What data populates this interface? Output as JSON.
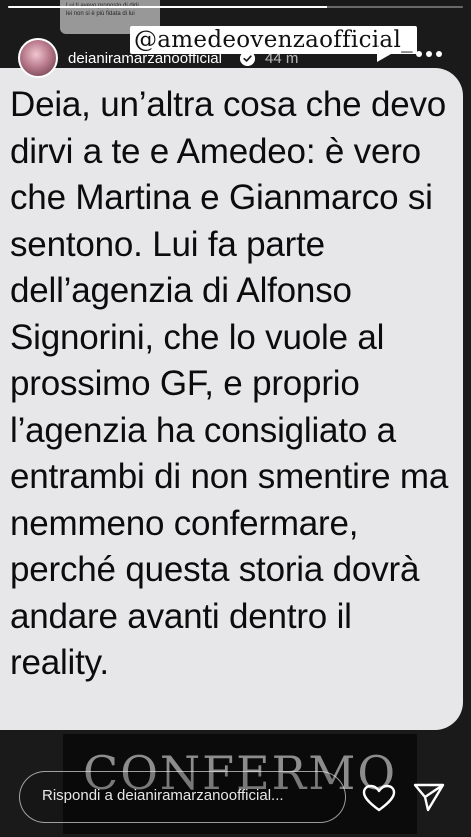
{
  "story": {
    "progress": 0.7,
    "background_chat": [
      "Lui ti avevo proposto di dirli",
      "lei non si è più fidata di lui"
    ]
  },
  "header": {
    "username": "deianiramarzanoofficial",
    "time": "44 m",
    "mention": "@amedeovenzaofficial_",
    "verified_icon": "verified-badge-icon",
    "play_icon": "play-icon",
    "more_icon": "more-options-icon"
  },
  "card": {
    "text": "Deia, un’altra cosa che devo dirvi a te e Amedeo: è vero che Martina e Gianmarco si sentono. Lui fa parte dell’agenzia di Alfonso Signorini, che lo vuole al prossimo GF, e proprio l’agenzia ha consigliato a entrambi di non smentire ma nemmeno confermare, perché questa storia dovrà andare avanti dentro il reality."
  },
  "caption": {
    "text": "CONFERMO"
  },
  "reply": {
    "placeholder": "Rispondi a deianiramarzanoofficial...",
    "heart_icon": "heart-icon",
    "send_icon": "send-icon"
  }
}
